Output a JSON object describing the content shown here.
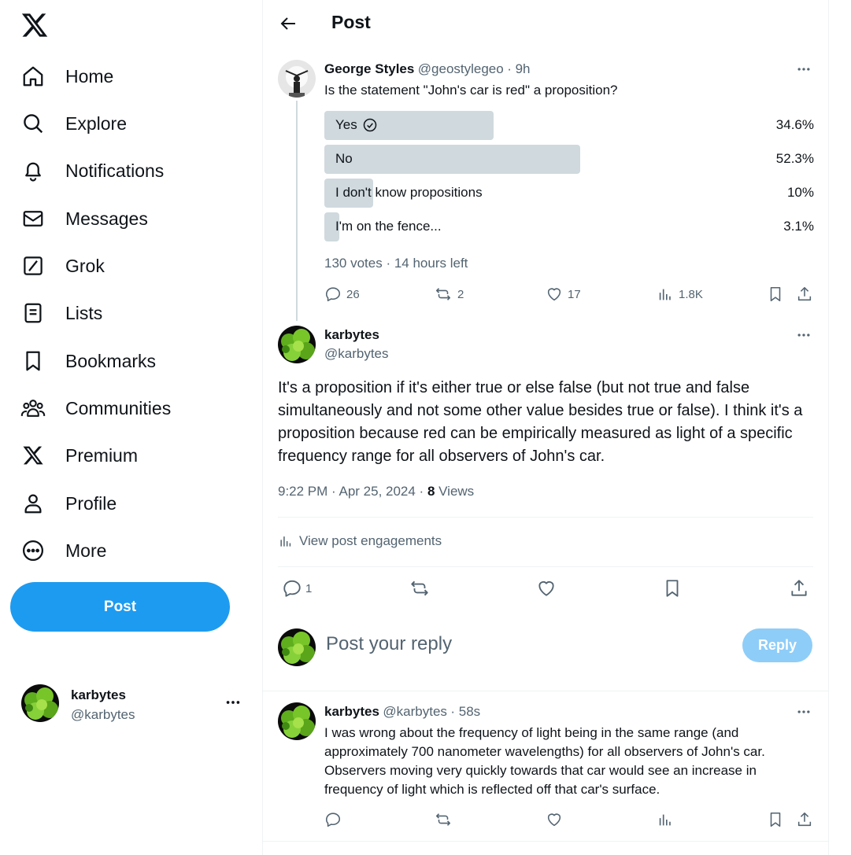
{
  "sidebar": {
    "logo_icon": "x-logo-icon",
    "items": [
      {
        "label": "Home",
        "icon": "home-icon"
      },
      {
        "label": "Explore",
        "icon": "search-icon"
      },
      {
        "label": "Notifications",
        "icon": "bell-icon"
      },
      {
        "label": "Messages",
        "icon": "envelope-icon"
      },
      {
        "label": "Grok",
        "icon": "grok-icon"
      },
      {
        "label": "Lists",
        "icon": "list-icon"
      },
      {
        "label": "Bookmarks",
        "icon": "bookmark-icon"
      },
      {
        "label": "Communities",
        "icon": "people-icon"
      },
      {
        "label": "Premium",
        "icon": "x-logo-icon"
      },
      {
        "label": "Profile",
        "icon": "person-icon"
      },
      {
        "label": "More",
        "icon": "more-circle-icon"
      }
    ],
    "post_label": "Post",
    "account": {
      "name": "karbytes",
      "handle": "@karbytes"
    }
  },
  "header": {
    "title": "Post"
  },
  "parent_post": {
    "name": "George Styles",
    "handle": "@geostylegeo",
    "time": "· 9h",
    "text": "Is the statement \"John's car is red\" a proposition?",
    "poll": {
      "options": [
        {
          "label": "Yes",
          "percent": "34.6%",
          "fraction": 0.346,
          "selected": true
        },
        {
          "label": "No",
          "percent": "52.3%",
          "fraction": 0.523,
          "selected": false
        },
        {
          "label": "I don't know propositions",
          "percent": "10%",
          "fraction": 0.1,
          "selected": false
        },
        {
          "label": "I'm on the fence...",
          "percent": "3.1%",
          "fraction": 0.031,
          "selected": false
        }
      ],
      "summary": "130 votes · 14 hours left"
    },
    "stats": {
      "replies": "26",
      "reposts": "2",
      "likes": "17",
      "views": "1.8K"
    }
  },
  "main_post": {
    "name": "karbytes",
    "handle": "@karbytes",
    "text": "It's a proposition if it's either true or else false (but not true and false simultaneously and not some other value besides true or false). I think it's a proposition because red can be empirically measured as light of a specific frequency range for all observers of John's car.",
    "timestamp": "9:22 PM · Apr 25, 2024 · ",
    "views_count": "8",
    "views_label": " Views",
    "engagements_label": "View post engagements",
    "stats": {
      "replies": "1"
    }
  },
  "reply_box": {
    "placeholder": "Post your reply",
    "button_label": "Reply"
  },
  "reply_post": {
    "name": "karbytes",
    "handle": "@karbytes",
    "time": "· 58s",
    "text": "I was wrong about the frequency of light being in the same range (and approximately 700 nanometer wavelengths) for all observers of John's car. Observers moving very quickly towards that car would see an increase in frequency of light which is reflected off that car's surface."
  },
  "colors": {
    "accent": "#1d9bf0",
    "reply_disabled": "#8ecdf8",
    "muted": "#536471",
    "poll_bar": "#cfd9de"
  }
}
